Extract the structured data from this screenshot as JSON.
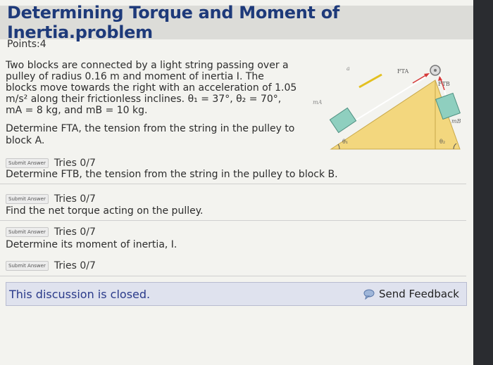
{
  "header": {
    "title": "Determining Torque and Moment of Inertia.problem"
  },
  "points": "Points:4",
  "problem": {
    "l1": "Two blocks are connected by a light string passing over a",
    "l2": "pulley of radius 0.16 m and moment of inertia I. The",
    "l3": "blocks move towards the right with an acceleration of 1.05",
    "l4": "m/s² along their frictionless inclines. θ₁ = 37°, θ₂ = 70°,",
    "l5": "mA = 8 kg, and mB = 10 kg."
  },
  "questions": [
    {
      "text_l1": "Determine FTA, the tension from the string in the pulley to",
      "text_l2": "block A.",
      "submit": "Submit Answer",
      "tries": "Tries 0/7"
    },
    {
      "text_l1": "Determine FTB, the tension from the string in the pulley to block B.",
      "submit": "Submit Answer",
      "tries": "Tries 0/7"
    },
    {
      "text_l1": "Find the net torque acting on the pulley.",
      "submit": "Submit Answer",
      "tries": "Tries 0/7"
    },
    {
      "text_l1": "Determine its moment of inertia, I.",
      "submit": "Submit Answer",
      "tries": "Tries 0/7"
    }
  ],
  "diagram": {
    "label_a": "a",
    "label_fta": "FTA",
    "label_ftb": "FTB",
    "label_ma": "mA",
    "label_mb": "mB",
    "label_theta1": "θ₁",
    "label_theta2": "θ₂"
  },
  "footer": {
    "closed": "This discussion is closed.",
    "feedback": "Send Feedback"
  },
  "colors": {
    "title": "#1e3a7a",
    "incline": "#f3d77e",
    "block": "#8fcfbf",
    "arrow": "#d63a3a"
  }
}
